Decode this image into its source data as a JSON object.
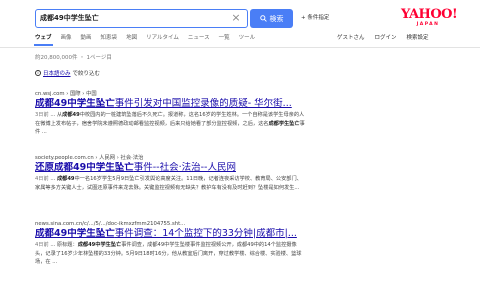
{
  "search": {
    "query": "成都49中学生坠亡",
    "clear_icon": "close-icon",
    "button_label": "検索",
    "conditions_label": "+ 条件指定"
  },
  "logo": {
    "main": "YAHOO!",
    "sub": "JAPAN"
  },
  "tabs": [
    "ウェブ",
    "画像",
    "動画",
    "知恵袋",
    "地図",
    "リアルタイム",
    "ニュース",
    "一覧",
    "ツール"
  ],
  "user_links": [
    "ゲストさん",
    "ログイン",
    "検索設定"
  ],
  "result_count": "約20,800,000件 ・ 1ページ目",
  "jp_filter": {
    "link": "日本語のみ",
    "rest": "で絞り込む"
  },
  "results": [
    {
      "url": "cn.wsj.com › 国際 › 中国",
      "title_bold": "成都49中学生坠亡",
      "title_rest": "事件引发对中国监控录像的质疑- 华尔街...",
      "date": "3日前",
      "snippet_pre": " ... 从",
      "snippet_bold": "成都49",
      "snippet_mid": "中校园内的一桩建筑坠落后不久死亡。报道称，这名16岁的学生姓林。一个自称是该学生母亲的人在微博上发布帖子，宿舍学院未遵照德政动邮看监控视频，后来只给她看了部分监控视频，之后，这名",
      "snippet_bold2": "成都学生坠亡",
      "snippet_end": "事件 ..."
    },
    {
      "url": "society.people.com.cn › 人民网 › 社会·法治",
      "title_bold": "还原成都49中学生坠亡",
      "title_rest": "事件--社会·法治--人民网",
      "date": "4日前",
      "snippet_pre": " ... ",
      "snippet_bold": "成都49",
      "snippet_mid": "中一名16岁学生5月9日坠亡引发舆论高度关注。11日晚，记者连夜采访学校、教育局、公安部门、家属等多方关键人士，试图还原事件来龙去脉。关键监控视频有无缺失？教护车有没有及时赶到？坠楼是如何发生...",
      "snippet_bold2": "",
      "snippet_end": ""
    },
    {
      "url": "news.sina.com.cn/c/.../5/.../doc-ikmxzfmm2104755.sht...",
      "title_bold": "成都49中学生坠亡",
      "title_rest": "事件调查：14个监控下的33分钟|成都市|...",
      "date": "4日前",
      "snippet_pre": " ... 原标题：",
      "snippet_bold": "成都49中学生坠亡",
      "snippet_mid": "事件调查，成都49中学生坠楼事件监控视频公开，成都49中的14个监控摄像头，记录了16岁少年林坠楼的33分钟。5月9日18时16分，他从教室后门离开，穿过教学楼、综合楼、实验楼、篮球场，在 ...",
      "snippet_bold2": "",
      "snippet_end": ""
    }
  ]
}
